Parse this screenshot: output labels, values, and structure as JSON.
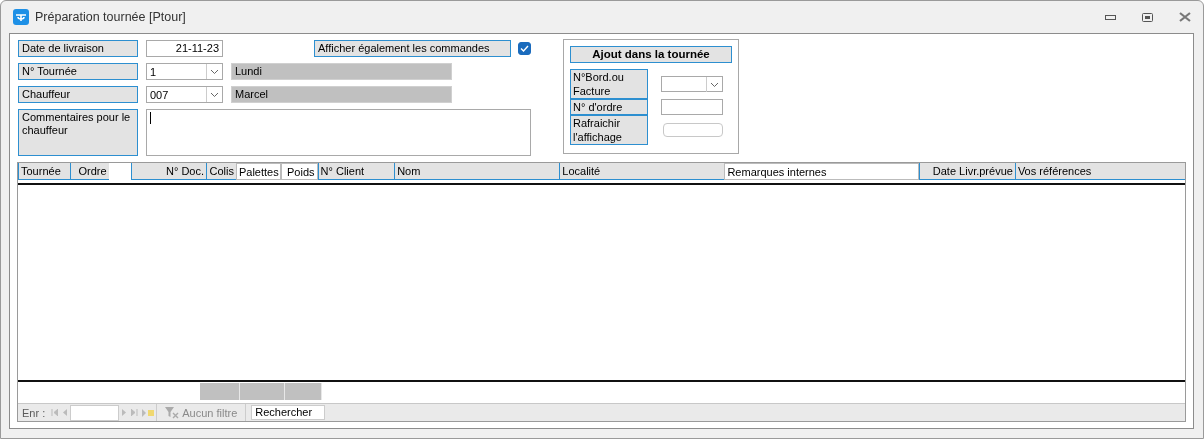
{
  "window": {
    "title": "Préparation tournée [Ptour]"
  },
  "form": {
    "date": {
      "label": "Date de livraison",
      "value": "21-11-23"
    },
    "show_orders": {
      "label": "Afficher également les commandes",
      "checked": true
    },
    "tour": {
      "label": "N° Tournée",
      "value": "1",
      "display": "Lundi"
    },
    "driver": {
      "label": "Chauffeur",
      "value": "007",
      "display": "Marcel"
    },
    "comments": {
      "label": "Commentaires pour le chauffeur"
    }
  },
  "add_group": {
    "title": "Ajout dans la tournée",
    "rows": [
      {
        "label": "N°Bord.ou Facture",
        "kind": "combo"
      },
      {
        "label": "N° d'ordre",
        "kind": "text"
      },
      {
        "label": "Rafraichir l'affichage",
        "kind": "button"
      }
    ]
  },
  "table": {
    "columns": [
      {
        "label": "Tournée",
        "shaded": true
      },
      {
        "label": "Ordre",
        "shaded": true
      },
      {
        "label": "N° Doc.",
        "shaded": true
      },
      {
        "label": "Colis",
        "shaded": true
      },
      {
        "label": "Palettes",
        "shaded": false
      },
      {
        "label": "Poids",
        "shaded": false
      },
      {
        "label": "N° Client",
        "shaded": true
      },
      {
        "label": "Nom",
        "shaded": true
      },
      {
        "label": "Localité",
        "shaded": true
      },
      {
        "label": "Remarques internes",
        "shaded": false
      },
      {
        "label": "Date Livr.prévue",
        "shaded": true
      },
      {
        "label": "Vos références",
        "shaded": true
      }
    ]
  },
  "navigator": {
    "label": "Enr :",
    "filter": "Aucun filtre",
    "filter_disabled": true,
    "search": "Rechercher"
  }
}
